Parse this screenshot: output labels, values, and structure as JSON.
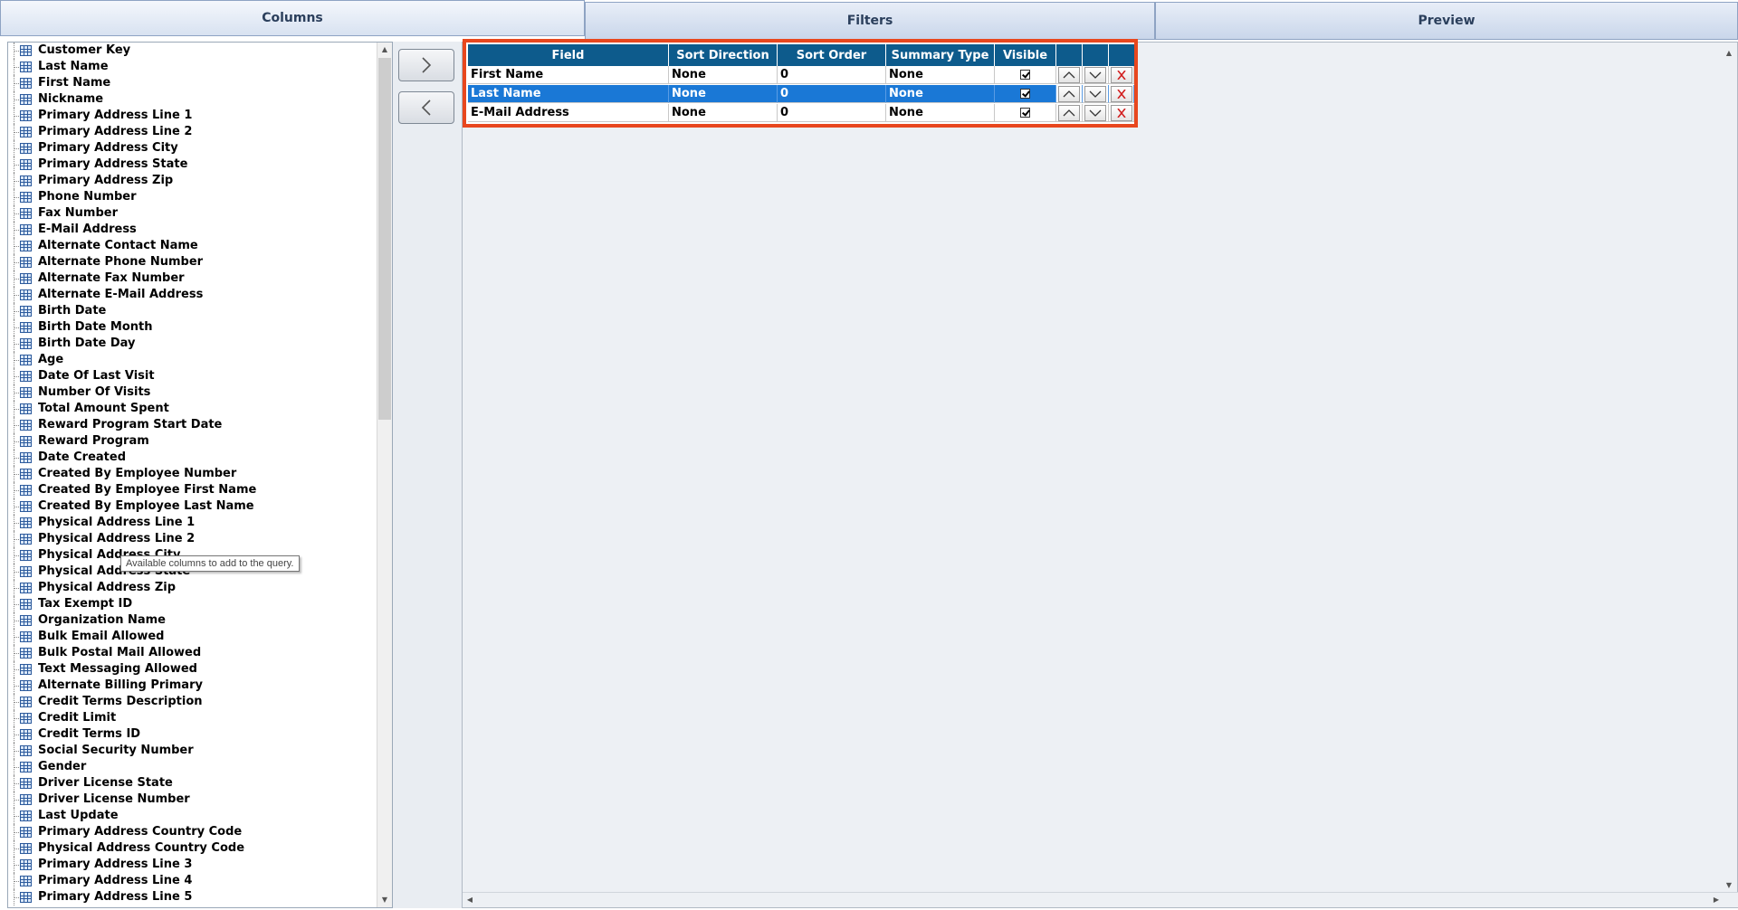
{
  "tabs": [
    {
      "label": "Columns"
    },
    {
      "label": "Filters"
    },
    {
      "label": "Preview"
    }
  ],
  "available_columns": [
    "Customer Key",
    "Last Name",
    "First Name",
    "Nickname",
    "Primary Address Line 1",
    "Primary Address Line 2",
    "Primary Address City",
    "Primary Address State",
    "Primary Address Zip",
    "Phone Number",
    "Fax Number",
    "E-Mail Address",
    "Alternate Contact Name",
    "Alternate Phone Number",
    "Alternate Fax Number",
    "Alternate E-Mail Address",
    "Birth Date",
    "Birth Date Month",
    "Birth Date Day",
    "Age",
    "Date Of Last Visit",
    "Number Of Visits",
    "Total Amount Spent",
    "Reward Program Start Date",
    "Reward Program",
    "Date Created",
    "Created By Employee Number",
    "Created By Employee First Name",
    "Created By Employee Last Name",
    "Physical Address Line 1",
    "Physical Address Line 2",
    "Physical Address City",
    "Physical Address State",
    "Physical Address Zip",
    "Tax Exempt ID",
    "Organization Name",
    "Bulk Email Allowed",
    "Bulk Postal Mail Allowed",
    "Text Messaging Allowed",
    "Alternate Billing Primary",
    "Credit Terms Description",
    "Credit Limit",
    "Credit Terms ID",
    "Social Security Number",
    "Gender",
    "Driver License State",
    "Driver License Number",
    "Last Update",
    "Primary Address Country Code",
    "Physical Address Country Code",
    "Primary Address Line 3",
    "Primary Address Line 4",
    "Primary Address Line 5"
  ],
  "tooltip": "Available columns to add to the query.",
  "grid": {
    "headers": {
      "field": "Field",
      "sort_direction": "Sort Direction",
      "sort_order": "Sort Order",
      "summary_type": "Summary Type",
      "visible": "Visible"
    },
    "rows": [
      {
        "field": "First Name",
        "sort_direction": "None",
        "sort_order": "0",
        "summary_type": "None",
        "visible": true
      },
      {
        "field": "Last Name",
        "sort_direction": "None",
        "sort_order": "0",
        "summary_type": "None",
        "visible": true,
        "selected": true
      },
      {
        "field": "E-Mail Address",
        "sort_direction": "None",
        "sort_order": "0",
        "summary_type": "None",
        "visible": true
      }
    ]
  },
  "colors": {
    "header_bg": "#0d5b8c",
    "selected_row": "#1a78d6",
    "highlight_border": "#e8471e",
    "delete_icon": "#d21f1f"
  },
  "icons": {
    "add": "chevron-right-icon",
    "remove": "chevron-left-icon",
    "move_up": "chevron-up-icon",
    "move_down": "chevron-down-icon",
    "delete": "close-icon",
    "field": "table-field-icon"
  }
}
